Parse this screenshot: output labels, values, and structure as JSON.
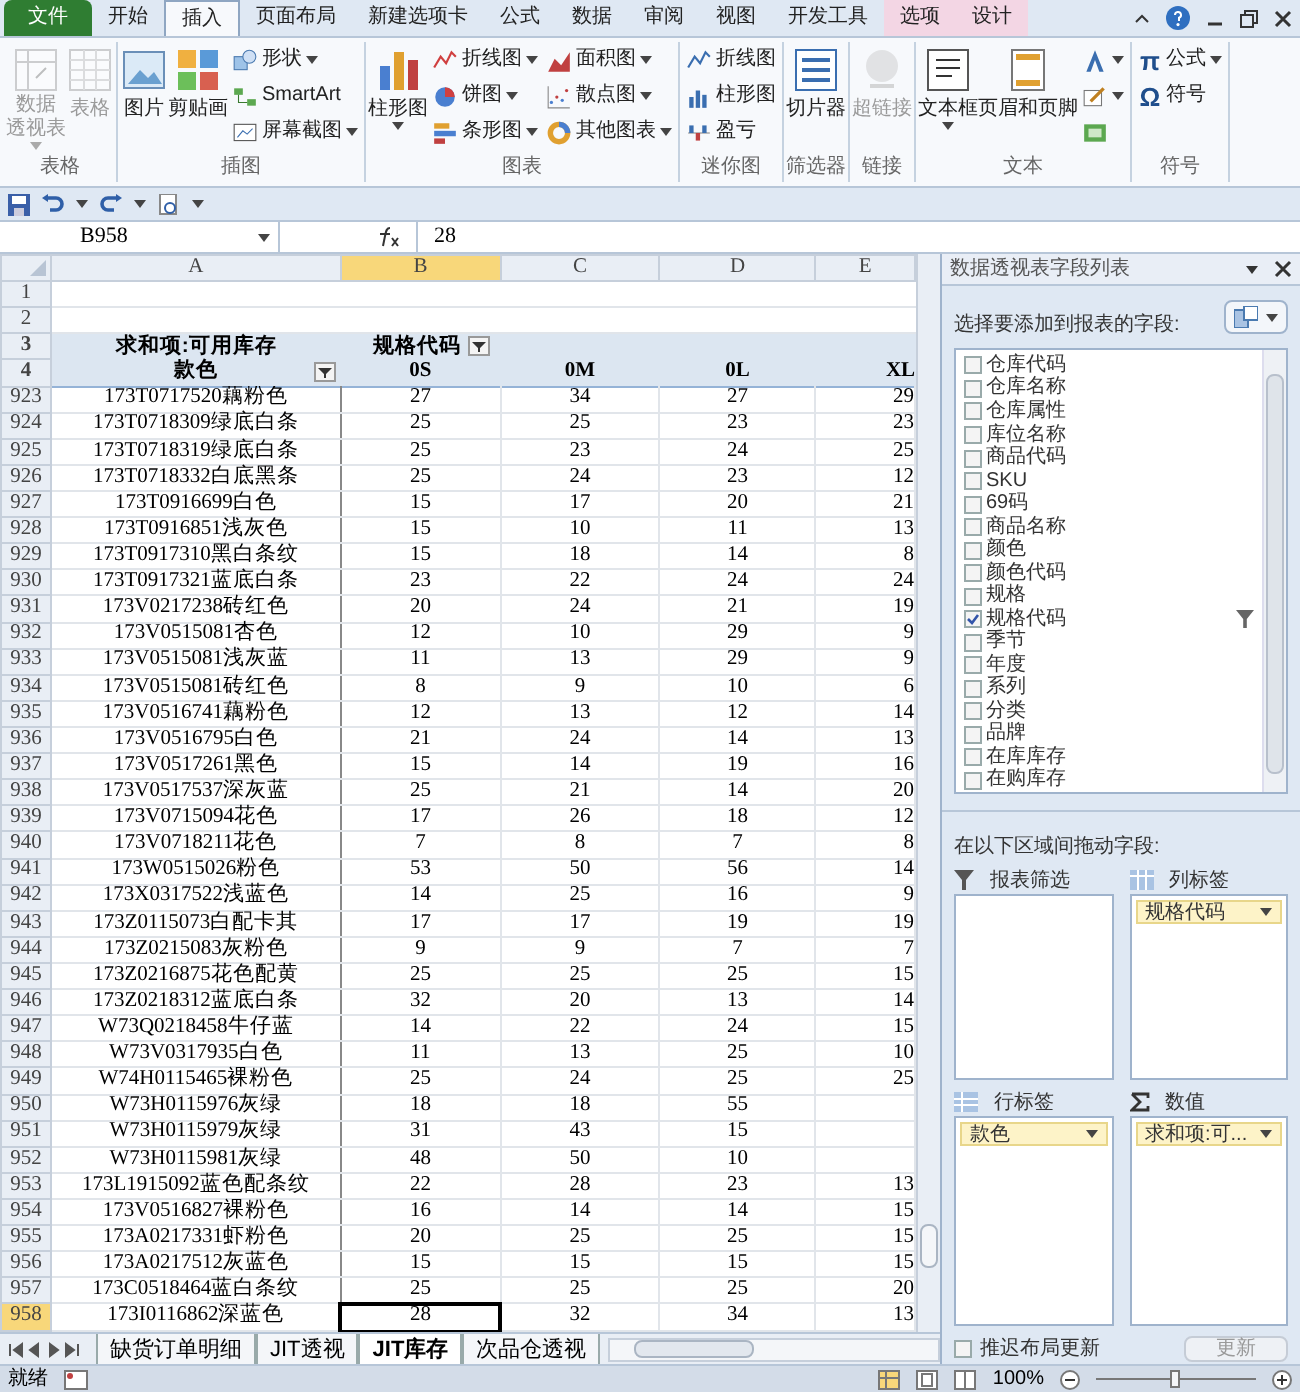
{
  "ribbon_tabs": [
    {
      "label": "文件",
      "kind": "file",
      "selected": false
    },
    {
      "label": "开始",
      "kind": "normal",
      "selected": false
    },
    {
      "label": "插入",
      "kind": "normal",
      "selected": true
    },
    {
      "label": "页面布局",
      "kind": "normal",
      "selected": false
    },
    {
      "label": "新建选项卡",
      "kind": "normal",
      "selected": false
    },
    {
      "label": "公式",
      "kind": "normal",
      "selected": false
    },
    {
      "label": "数据",
      "kind": "normal",
      "selected": false
    },
    {
      "label": "审阅",
      "kind": "normal",
      "selected": false
    },
    {
      "label": "视图",
      "kind": "normal",
      "selected": false
    },
    {
      "label": "开发工具",
      "kind": "normal",
      "selected": false
    },
    {
      "label": "选项",
      "kind": "contextual",
      "selected": false
    },
    {
      "label": "设计",
      "kind": "contextual",
      "selected": false
    }
  ],
  "ribbon_groups": [
    {
      "title": "表格",
      "items": [
        {
          "label_lines": [
            "数据",
            "透视表"
          ],
          "kind": "large",
          "disabled": true,
          "dropdown": true
        },
        {
          "label": "表格",
          "kind": "large",
          "disabled": true,
          "dropdown": false
        }
      ]
    },
    {
      "title": "插图",
      "items": [
        {
          "label": "图片",
          "kind": "large",
          "disabled": false,
          "dropdown": false
        },
        {
          "label": "剪贴画",
          "kind": "large",
          "disabled": false,
          "dropdown": false
        },
        {
          "label": "形状",
          "kind": "small",
          "disabled": false,
          "dropdown": true
        },
        {
          "label": "SmartArt",
          "kind": "small",
          "disabled": false,
          "dropdown": false
        },
        {
          "label": "屏幕截图",
          "kind": "small",
          "disabled": false,
          "dropdown": true
        }
      ]
    },
    {
      "title": "图表",
      "items": [
        {
          "label": "柱形图",
          "kind": "large",
          "disabled": false,
          "dropdown": true
        },
        {
          "label": "折线图",
          "kind": "small",
          "disabled": false,
          "dropdown": true
        },
        {
          "label": "饼图",
          "kind": "small",
          "disabled": false,
          "dropdown": true
        },
        {
          "label": "条形图",
          "kind": "small",
          "disabled": false,
          "dropdown": true
        },
        {
          "label": "面积图",
          "kind": "small",
          "disabled": false,
          "dropdown": true
        },
        {
          "label": "散点图",
          "kind": "small",
          "disabled": false,
          "dropdown": true
        },
        {
          "label": "其他图表",
          "kind": "small",
          "disabled": false,
          "dropdown": true
        }
      ]
    },
    {
      "title": "迷你图",
      "items": [
        {
          "label": "折线图",
          "kind": "small",
          "disabled": false,
          "dropdown": false
        },
        {
          "label": "柱形图",
          "kind": "small",
          "disabled": false,
          "dropdown": false
        },
        {
          "label": "盈亏",
          "kind": "small",
          "disabled": false,
          "dropdown": false
        }
      ]
    },
    {
      "title": "筛选器",
      "items": [
        {
          "label": "切片器",
          "kind": "large",
          "disabled": false,
          "dropdown": false
        }
      ]
    },
    {
      "title": "链接",
      "items": [
        {
          "label": "超链接",
          "kind": "large",
          "disabled": true,
          "dropdown": false
        }
      ]
    },
    {
      "title": "文本",
      "items": [
        {
          "label": "文本框",
          "kind": "large",
          "disabled": false,
          "dropdown": true
        },
        {
          "label": "页眉和页脚",
          "kind": "large",
          "disabled": false,
          "dropdown": false
        },
        {
          "kind": "small",
          "disabled": false,
          "dropdown": true
        },
        {
          "kind": "small",
          "disabled": false,
          "dropdown": true
        },
        {
          "kind": "small",
          "disabled": false,
          "dropdown": false
        }
      ]
    },
    {
      "title": "符号",
      "items": [
        {
          "glyph": "π",
          "label": "公式",
          "kind": "small",
          "disabled": false,
          "dropdown": true
        },
        {
          "glyph": "Ω",
          "label": "符号",
          "kind": "small",
          "disabled": false,
          "dropdown": false
        }
      ]
    }
  ],
  "formula_bar": {
    "cell": "B958",
    "formula": "28"
  },
  "sheet": {
    "columns": [
      {
        "label": "A",
        "selected": false
      },
      {
        "label": "B",
        "selected": true
      },
      {
        "label": "C",
        "selected": false
      },
      {
        "label": "D",
        "selected": false
      },
      {
        "label": "E",
        "selected": false
      }
    ],
    "header_rows": [
      "1",
      "2",
      "3",
      "4"
    ],
    "pivot": {
      "value_field": "求和项:可用库存",
      "column_field": "规格代码",
      "row_field": "款色",
      "column_items": [
        "0S",
        "0M",
        "0L",
        "XL"
      ]
    },
    "rows": [
      {
        "num": "923",
        "label": "173T0717520藕粉色",
        "values": [
          "27",
          "34",
          "27",
          "29"
        ],
        "selected": false
      },
      {
        "num": "924",
        "label": "173T0718309绿底白条",
        "values": [
          "25",
          "25",
          "23",
          "23"
        ],
        "selected": false
      },
      {
        "num": "925",
        "label": "173T0718319绿底白条",
        "values": [
          "25",
          "23",
          "24",
          "25"
        ],
        "selected": false
      },
      {
        "num": "926",
        "label": "173T0718332白底黑条",
        "values": [
          "25",
          "24",
          "23",
          "12"
        ],
        "selected": false
      },
      {
        "num": "927",
        "label": "173T0916699白色",
        "values": [
          "15",
          "17",
          "20",
          "21"
        ],
        "selected": false
      },
      {
        "num": "928",
        "label": "173T0916851浅灰色",
        "values": [
          "15",
          "10",
          "11",
          "13"
        ],
        "selected": false
      },
      {
        "num": "929",
        "label": "173T0917310黑白条纹",
        "values": [
          "15",
          "18",
          "14",
          "8"
        ],
        "selected": false
      },
      {
        "num": "930",
        "label": "173T0917321蓝底白条",
        "values": [
          "23",
          "22",
          "24",
          "24"
        ],
        "selected": false
      },
      {
        "num": "931",
        "label": "173V0217238砖红色",
        "values": [
          "20",
          "24",
          "21",
          "19"
        ],
        "selected": false
      },
      {
        "num": "932",
        "label": "173V0515081杏色",
        "values": [
          "12",
          "10",
          "29",
          "9"
        ],
        "selected": false
      },
      {
        "num": "933",
        "label": "173V0515081浅灰蓝",
        "values": [
          "11",
          "13",
          "29",
          "9"
        ],
        "selected": false
      },
      {
        "num": "934",
        "label": "173V0515081砖红色",
        "values": [
          "8",
          "9",
          "10",
          "6"
        ],
        "selected": false
      },
      {
        "num": "935",
        "label": "173V0516741藕粉色",
        "values": [
          "12",
          "13",
          "12",
          "14"
        ],
        "selected": false
      },
      {
        "num": "936",
        "label": "173V0516795白色",
        "values": [
          "21",
          "24",
          "14",
          "13"
        ],
        "selected": false
      },
      {
        "num": "937",
        "label": "173V0517261黑色",
        "values": [
          "15",
          "14",
          "19",
          "16"
        ],
        "selected": false
      },
      {
        "num": "938",
        "label": "173V0517537深灰蓝",
        "values": [
          "25",
          "21",
          "14",
          "20"
        ],
        "selected": false
      },
      {
        "num": "939",
        "label": "173V0715094花色",
        "values": [
          "17",
          "26",
          "18",
          "12"
        ],
        "selected": false
      },
      {
        "num": "940",
        "label": "173V0718211花色",
        "values": [
          "7",
          "8",
          "7",
          "8"
        ],
        "selected": false
      },
      {
        "num": "941",
        "label": "173W0515026粉色",
        "values": [
          "53",
          "50",
          "56",
          "14"
        ],
        "selected": false
      },
      {
        "num": "942",
        "label": "173X0317522浅蓝色",
        "values": [
          "14",
          "25",
          "16",
          "9"
        ],
        "selected": false
      },
      {
        "num": "943",
        "label": "173Z0115073白配卡其",
        "values": [
          "17",
          "17",
          "19",
          "19"
        ],
        "selected": false
      },
      {
        "num": "944",
        "label": "173Z0215083灰粉色",
        "values": [
          "9",
          "9",
          "7",
          "7"
        ],
        "selected": false
      },
      {
        "num": "945",
        "label": "173Z0216875花色配黄",
        "values": [
          "25",
          "25",
          "25",
          "15"
        ],
        "selected": false
      },
      {
        "num": "946",
        "label": "173Z0218312蓝底白条",
        "values": [
          "32",
          "20",
          "13",
          "14"
        ],
        "selected": false
      },
      {
        "num": "947",
        "label": "W73Q0218458牛仔蓝",
        "values": [
          "14",
          "22",
          "24",
          "15"
        ],
        "selected": false
      },
      {
        "num": "948",
        "label": "W73V0317935白色",
        "values": [
          "11",
          "13",
          "25",
          "10"
        ],
        "selected": false
      },
      {
        "num": "949",
        "label": "W74H0115465裸粉色",
        "values": [
          "25",
          "24",
          "25",
          "25"
        ],
        "selected": false
      },
      {
        "num": "950",
        "label": "W73H0115976灰绿",
        "values": [
          "18",
          "18",
          "55"
        ],
        "selected": false
      },
      {
        "num": "951",
        "label": "W73H0115979灰绿",
        "values": [
          "31",
          "43",
          "15"
        ],
        "selected": false
      },
      {
        "num": "952",
        "label": "W73H0115981灰绿",
        "values": [
          "48",
          "50",
          "10"
        ],
        "selected": false
      },
      {
        "num": "953",
        "label": "173L1915092蓝色配条纹",
        "values": [
          "22",
          "28",
          "23",
          "13"
        ],
        "selected": false
      },
      {
        "num": "954",
        "label": "173V0516827裸粉色",
        "values": [
          "16",
          "14",
          "14",
          "15"
        ],
        "selected": false
      },
      {
        "num": "955",
        "label": "173A0217331虾粉色",
        "values": [
          "20",
          "25",
          "25",
          "15"
        ],
        "selected": false
      },
      {
        "num": "956",
        "label": "173A0217512灰蓝色",
        "values": [
          "15",
          "15",
          "15",
          "15"
        ],
        "selected": false
      },
      {
        "num": "957",
        "label": "173C0518464蓝白条纹",
        "values": [
          "25",
          "25",
          "25",
          "20"
        ],
        "selected": false
      },
      {
        "num": "958",
        "label": "173I0116862深蓝色",
        "values": [
          "28",
          "32",
          "34",
          "13"
        ],
        "selected": true
      }
    ]
  },
  "sheet_tabs": [
    {
      "label": "缺货订单明细",
      "selected": false
    },
    {
      "label": "JIT透视",
      "selected": false
    },
    {
      "label": "JIT库存",
      "selected": true
    },
    {
      "label": "次品仓透视",
      "selected": false
    }
  ],
  "status_bar": {
    "status": "就绪",
    "zoom": "100%",
    "zoom_slider": {
      "level": 0.5
    }
  },
  "field_list": {
    "title": "数据透视表字段列表",
    "prompt": "选择要添加到报表的字段:",
    "fields": [
      {
        "label": "仓库代码",
        "checked": false,
        "filtered": false
      },
      {
        "label": "仓库名称",
        "checked": false,
        "filtered": false
      },
      {
        "label": "仓库属性",
        "checked": false,
        "filtered": false
      },
      {
        "label": "库位名称",
        "checked": false,
        "filtered": false
      },
      {
        "label": "商品代码",
        "checked": false,
        "filtered": false
      },
      {
        "label": "SKU",
        "checked": false,
        "filtered": false
      },
      {
        "label": "69码",
        "checked": false,
        "filtered": false
      },
      {
        "label": "商品名称",
        "checked": false,
        "filtered": false
      },
      {
        "label": "颜色",
        "checked": false,
        "filtered": false
      },
      {
        "label": "颜色代码",
        "checked": false,
        "filtered": false
      },
      {
        "label": "规格",
        "checked": false,
        "filtered": false
      },
      {
        "label": "规格代码",
        "checked": true,
        "filtered": true
      },
      {
        "label": "季节",
        "checked": false,
        "filtered": false
      },
      {
        "label": "年度",
        "checked": false,
        "filtered": false
      },
      {
        "label": "系列",
        "checked": false,
        "filtered": false
      },
      {
        "label": "分类",
        "checked": false,
        "filtered": false
      },
      {
        "label": "品牌",
        "checked": false,
        "filtered": false
      },
      {
        "label": "在库库存",
        "checked": false,
        "filtered": false
      },
      {
        "label": "在购库存",
        "checked": false,
        "filtered": false
      }
    ],
    "areas_prompt": "在以下区域间拖动字段:",
    "areas": [
      {
        "title": "报表筛选",
        "kind": "filter"
      },
      {
        "title": "列标签",
        "kind": "columns",
        "fields": [
          "规格代码"
        ]
      },
      {
        "title": "行标签",
        "kind": "rows",
        "fields": [
          "款色"
        ]
      },
      {
        "title": "数值",
        "kind": "values",
        "fields": [
          "求和项:可..."
        ]
      }
    ],
    "defer_update": {
      "label": "推迟布局更新",
      "checked": false
    },
    "update_button": {
      "label": "更新",
      "disabled": true
    }
  }
}
